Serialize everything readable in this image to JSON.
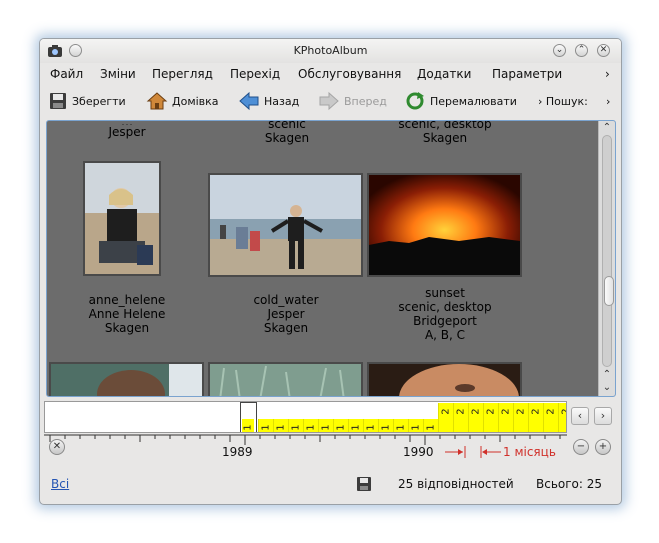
{
  "window": {
    "title": "KPhotoAlbum"
  },
  "menu": {
    "items": [
      "Файл",
      "Зміни",
      "Перегляд",
      "Перехід",
      "Обслуговування",
      "Додатки",
      "Параметри"
    ],
    "overflow": "›"
  },
  "toolbar": {
    "save": "Зберегти",
    "home": "Домівка",
    "back": "Назад",
    "forward": "Вперед",
    "redraw": "Перемалювати",
    "search": "› Пошук:",
    "overflow": "›"
  },
  "thumbnails": {
    "top_captions": [
      {
        "line1": "Jesper"
      },
      {
        "line1": "scenic",
        "line2": "Skagen"
      },
      {
        "line1": "scenic, desktop",
        "line2": "Skagen"
      }
    ],
    "items": [
      {
        "lines": [
          "anne_helene",
          "Anne Helene",
          "Skagen"
        ]
      },
      {
        "lines": [
          "cold_water",
          "Jesper",
          "Skagen"
        ]
      },
      {
        "lines": [
          "sunset",
          "scenic, desktop",
          "Bridgeport",
          "A, B, C"
        ]
      }
    ]
  },
  "dategraph": {
    "bars": [
      {
        "label": "1",
        "level": 0.45
      },
      {
        "label": "1",
        "level": 0.45
      },
      {
        "label": "1",
        "level": 0.45
      },
      {
        "label": "1",
        "level": 0.45
      },
      {
        "label": "1",
        "level": 0.45
      },
      {
        "label": "1",
        "level": 0.45
      },
      {
        "label": "1",
        "level": 0.45
      },
      {
        "label": "1",
        "level": 0.45
      },
      {
        "label": "1",
        "level": 0.45
      },
      {
        "label": "1",
        "level": 0.45
      },
      {
        "label": "1",
        "level": 0.45
      },
      {
        "label": "1",
        "level": 0.45
      },
      {
        "label": "2",
        "level": 1.0
      },
      {
        "label": "2",
        "level": 1.0
      },
      {
        "label": "2",
        "level": 1.0
      },
      {
        "label": "2",
        "level": 1.0
      },
      {
        "label": "2",
        "level": 1.0
      },
      {
        "label": "2",
        "level": 1.0
      },
      {
        "label": "2",
        "level": 1.0
      },
      {
        "label": "2",
        "level": 1.0
      },
      {
        "label": "2",
        "level": 1.0
      }
    ],
    "first_label": "1",
    "year_1": "1989",
    "year_2": "1990",
    "unit": "1 місяць"
  },
  "status": {
    "all_link": "Всі",
    "matches": "25 відповідностей",
    "total": "Всього: 25"
  },
  "colors": {
    "bar": "#ffff00",
    "background": "#6c6c6c",
    "unit_label": "#d0302a"
  }
}
